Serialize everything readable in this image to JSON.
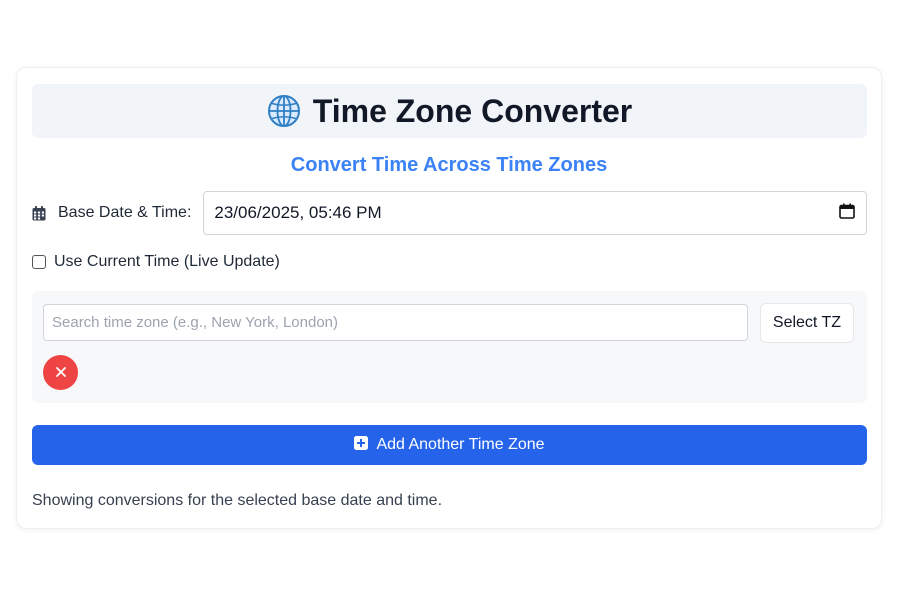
{
  "app": {
    "title": "Time Zone Converter",
    "subtitle": "Convert Time Across Time Zones"
  },
  "base_datetime": {
    "label": "Base Date & Time:",
    "value": "23/06/2025, 05:46 PM"
  },
  "live_update": {
    "label": "Use Current Time (Live Update)",
    "checked": false
  },
  "timezone_entry": {
    "search_value": "",
    "search_placeholder": "Search time zone (e.g., New York, London)",
    "select_label": "Select TZ",
    "remove_icon": "close-icon"
  },
  "add_button": {
    "label": "Add Another Time Zone",
    "icon": "plus-square-icon"
  },
  "footer": {
    "note": "Showing conversions for the selected base date and time."
  },
  "colors": {
    "accent_blue": "#3b82f6",
    "primary_button": "#2563eb",
    "remove_button": "#ef4444",
    "title_bg": "#f1f4f8"
  }
}
